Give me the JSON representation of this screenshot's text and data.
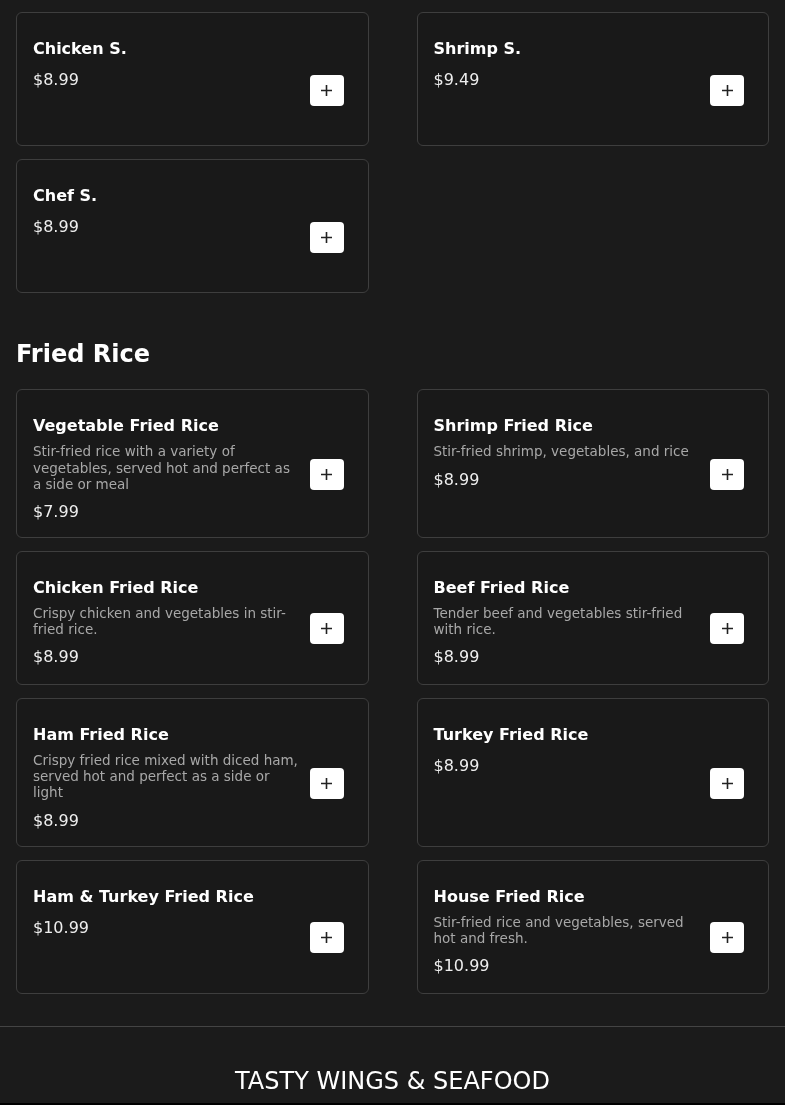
{
  "sections": [
    {
      "items": [
        {
          "name": "Chicken S.",
          "price": "$8.99"
        },
        {
          "name": "Shrimp S.",
          "price": "$9.49"
        },
        {
          "name": "Chef S.",
          "price": "$8.99"
        }
      ]
    },
    {
      "title": "Fried Rice",
      "items": [
        {
          "name": "Vegetable Fried Rice",
          "description": "Stir-fried rice with a variety of vegetables, served hot and perfect as a side or meal",
          "price": "$7.99"
        },
        {
          "name": "Shrimp Fried Rice",
          "description": "Stir-fried shrimp, vegetables, and rice",
          "price": "$8.99"
        },
        {
          "name": "Chicken Fried Rice",
          "description": "Crispy chicken and vegetables in stir-fried rice.",
          "price": "$8.99"
        },
        {
          "name": "Beef Fried Rice",
          "description": "Tender beef and vegetables stir-fried with rice.",
          "price": "$8.99"
        },
        {
          "name": "Ham Fried Rice",
          "description": "Crispy fried rice mixed with diced ham, served hot and perfect as a side or light",
          "price": "$8.99"
        },
        {
          "name": "Turkey Fried Rice",
          "price": "$8.99"
        },
        {
          "name": "Ham & Turkey Fried Rice",
          "price": "$10.99"
        },
        {
          "name": "House Fried Rice",
          "description": "Stir-fried rice and vegetables, served hot and fresh.",
          "price": "$10.99"
        }
      ]
    }
  ],
  "footer": {
    "brand": "TASTY WINGS & SEAFOOD"
  }
}
